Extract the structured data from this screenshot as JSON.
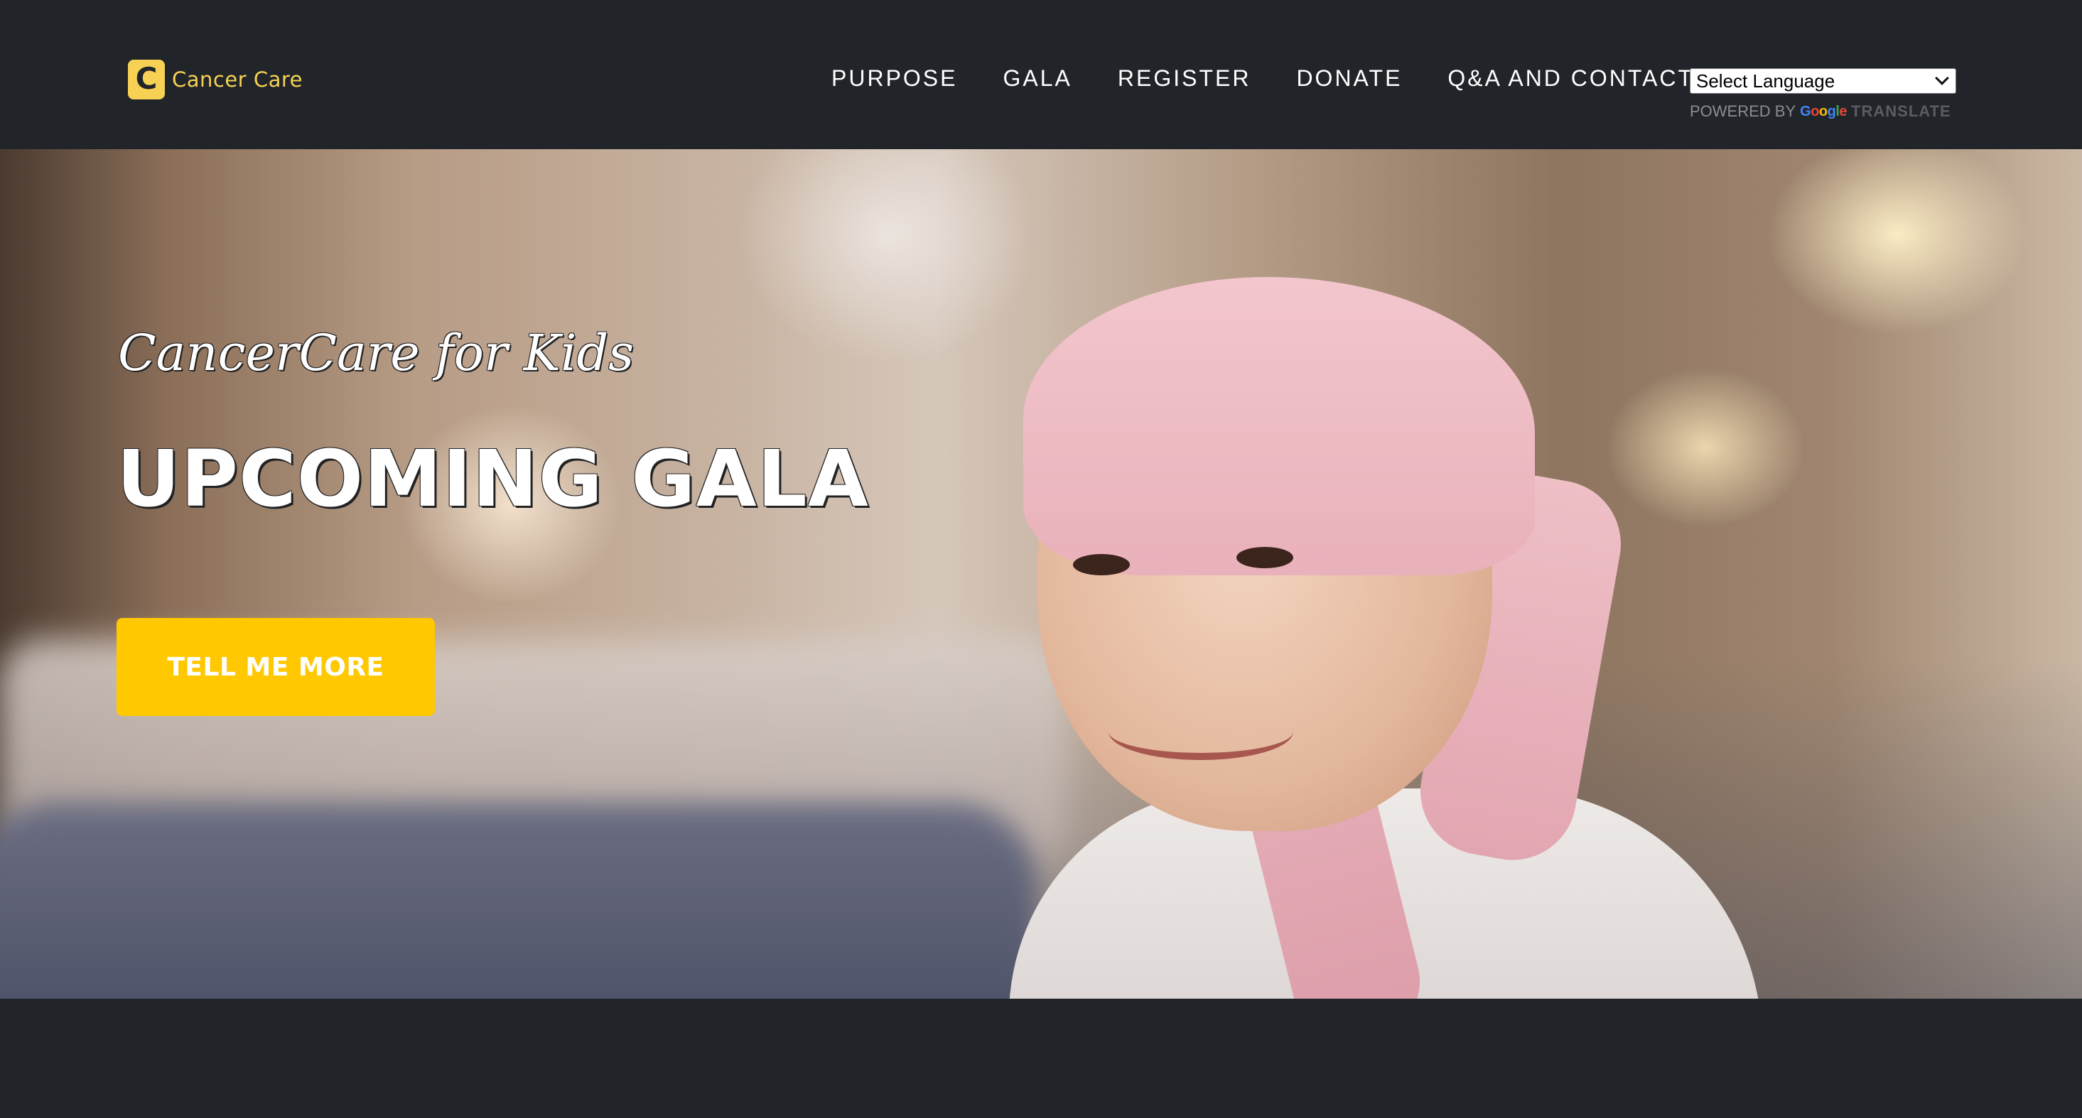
{
  "navbar": {
    "brand": {
      "mark": "C",
      "text": "Cancer Care"
    },
    "links": [
      {
        "label": "PURPOSE"
      },
      {
        "label": "GALA"
      },
      {
        "label": "REGISTER"
      },
      {
        "label": "DONATE"
      },
      {
        "label": "Q&A AND CONTACT"
      }
    ],
    "translate": {
      "select_value": "Select Language",
      "powered_by": "POWERED BY",
      "google": "Google",
      "translate_word": "TRANSLATE"
    }
  },
  "hero": {
    "subheading": "CancerCare for Kids",
    "heading": "UPCOMING GALA",
    "cta_label": "TELL ME MORE"
  },
  "colors": {
    "background": "#212529",
    "accent": "#ffc800",
    "brand": "#f7d154"
  }
}
